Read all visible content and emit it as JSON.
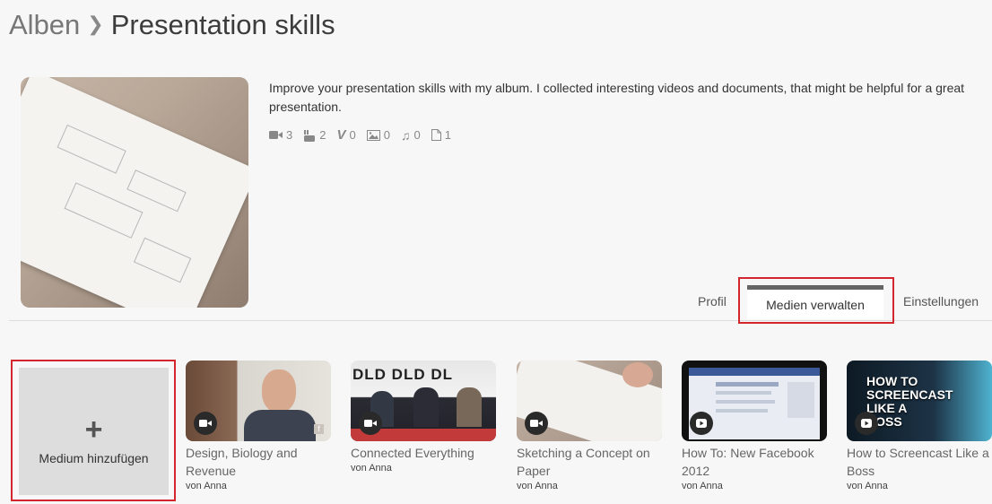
{
  "breadcrumb": {
    "root": "Alben",
    "separator": "❯",
    "current": "Presentation skills"
  },
  "album": {
    "description": "Improve your presentation skills with my album. I collected interesting videos and documents, that might be helpful for a great presentation.",
    "stats": [
      {
        "icon": "video-camera-icon",
        "count": "3"
      },
      {
        "icon": "youtube-icon",
        "count": "2"
      },
      {
        "icon": "vimeo-icon",
        "count": "0"
      },
      {
        "icon": "image-icon",
        "count": "0"
      },
      {
        "icon": "music-icon",
        "count": "0"
      },
      {
        "icon": "document-icon",
        "count": "1"
      }
    ]
  },
  "tabs": {
    "profile": "Profil",
    "manage": "Medien verwalten",
    "settings": "Einstellungen",
    "active": "Medien verwalten"
  },
  "add_media": {
    "label": "Medium hinzufügen"
  },
  "media": [
    {
      "title": "Design, Biology and Revenue",
      "by": "von",
      "author": "Anna",
      "badge": "video-camera-icon"
    },
    {
      "title": "Connected Everything",
      "by": "von",
      "author": "Anna",
      "badge": "video-camera-icon"
    },
    {
      "title": "Sketching a Concept on Paper",
      "by": "von",
      "author": "Anna",
      "badge": "video-camera-icon"
    },
    {
      "title": "How To: New Facebook 2012",
      "by": "von",
      "author": "Anna",
      "badge": "play-icon"
    },
    {
      "title": "How to Screencast Like a Boss",
      "by": "von",
      "author": "Anna",
      "badge": "play-icon",
      "thumb_text": "HOW TO SCREENCAST LIKE A BOSS"
    }
  ],
  "colors": {
    "highlight": "#d3262e",
    "active_tab_border": "#666666",
    "background": "#f7f7f7"
  }
}
